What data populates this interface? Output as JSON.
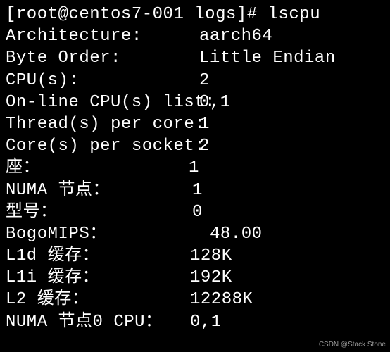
{
  "prompt": {
    "user": "root",
    "host": "centos7-001",
    "cwd": "logs",
    "symbol": "#",
    "command": "lscpu"
  },
  "rows": [
    {
      "label": "Architecture:",
      "value": "aarch64"
    },
    {
      "label": "Byte Order:",
      "value": "Little Endian"
    },
    {
      "label": "CPU(s):",
      "value": "2"
    },
    {
      "label": "On-line CPU(s) list:",
      "value": "0,1"
    },
    {
      "label": "Thread(s) per core:",
      "value": "1"
    },
    {
      "label": "Core(s) per socket:",
      "value": "2"
    },
    {
      "label": "座：",
      "value": "1",
      "labelWidth": "260px"
    },
    {
      "label": "NUMA 节点：",
      "value": "1",
      "labelWidth": "265px"
    },
    {
      "label": "型号：",
      "value": "0",
      "labelWidth": "265px"
    },
    {
      "label": "BogoMIPS：",
      "value": "48.00",
      "labelWidth": "290px"
    },
    {
      "label": "L1d 缓存：",
      "value": "128K",
      "labelWidth": "262px"
    },
    {
      "label": "L1i 缓存：",
      "value": "192K",
      "labelWidth": "262px"
    },
    {
      "label": "L2 缓存：",
      "value": "12288K",
      "labelWidth": "262px"
    },
    {
      "label": "NUMA 节点0 CPU：",
      "value": "0,1",
      "labelWidth": "262px"
    }
  ],
  "watermark": "CSDN @Stack Stone"
}
